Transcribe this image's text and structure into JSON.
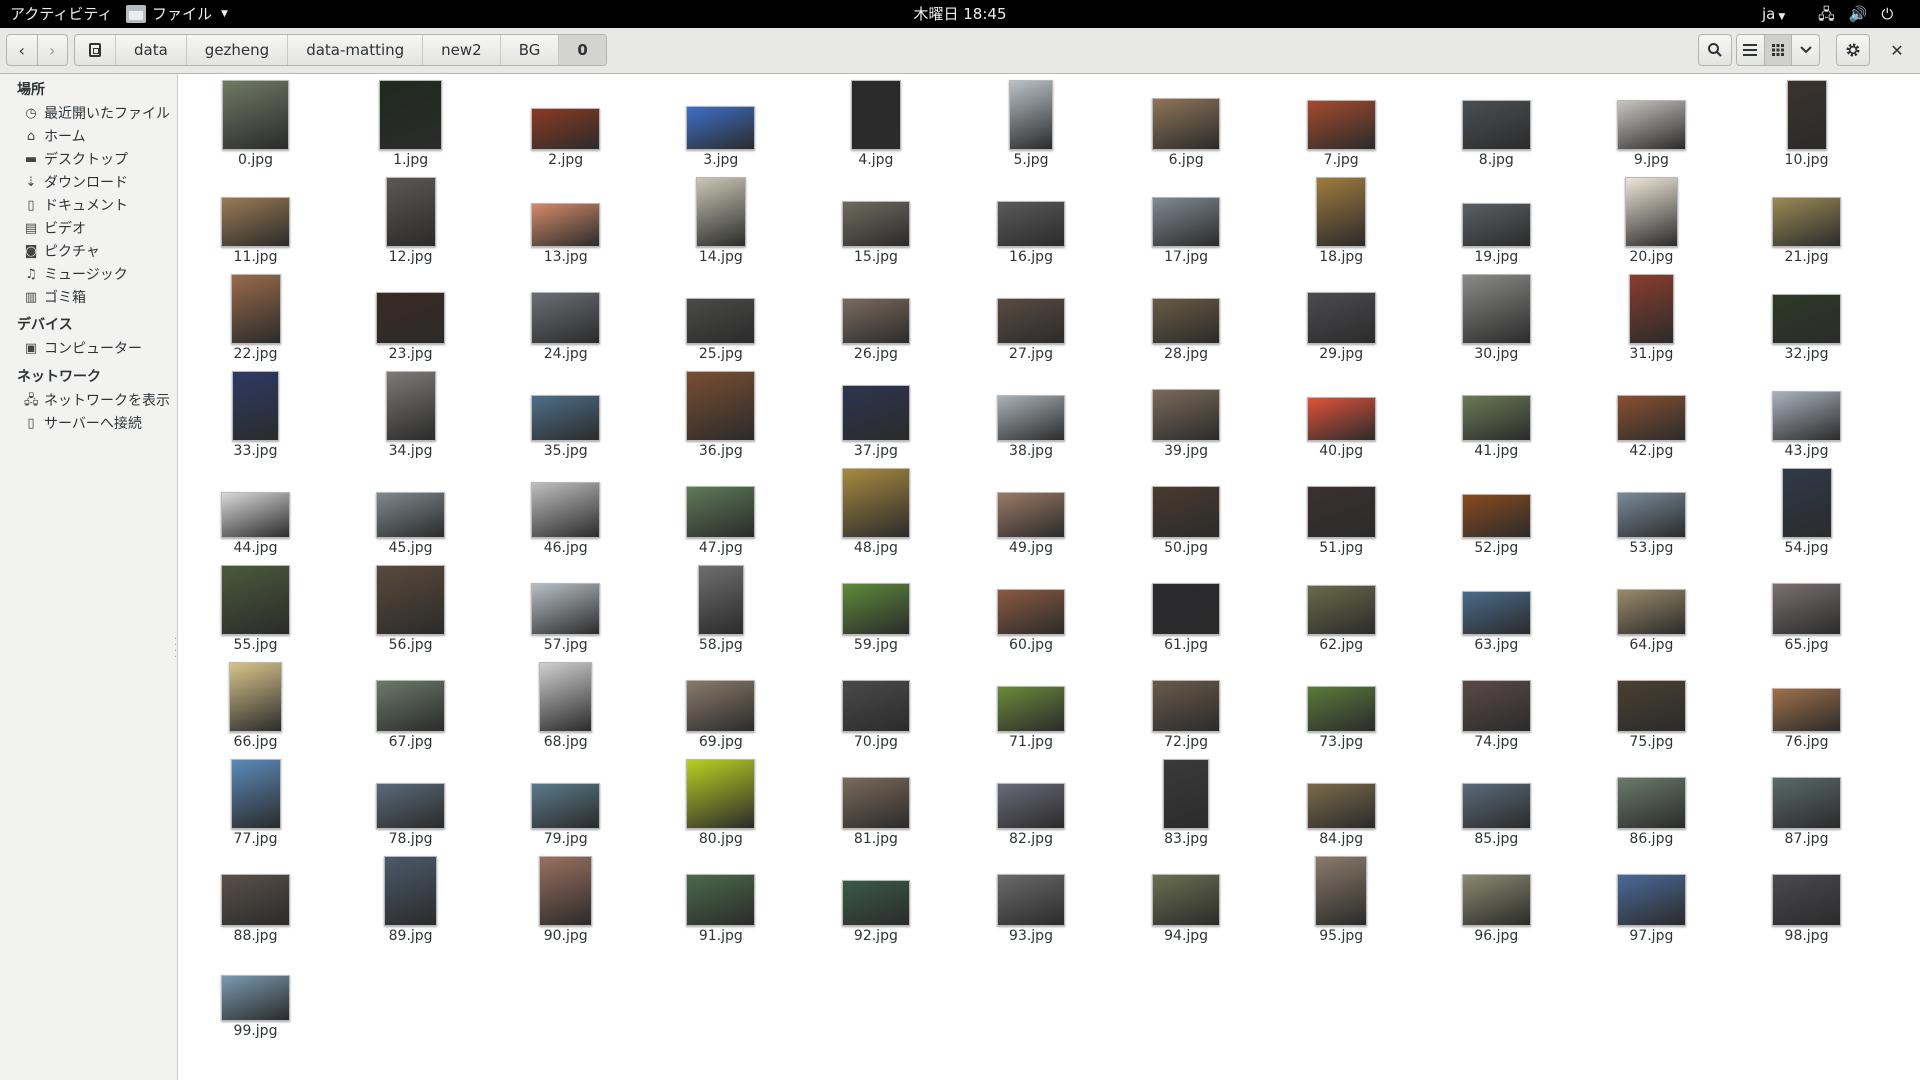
{
  "topbar": {
    "activities": "アクティビティ",
    "app_menu": "ファイル",
    "clock": "木曜日 18:45",
    "lang": "ja",
    "icons": [
      "network-icon",
      "volume-icon",
      "power-icon"
    ]
  },
  "header": {
    "back_icon": "chevron-left-icon",
    "forward_icon": "chevron-right-icon",
    "breadcrumbs": [
      "data",
      "gezheng",
      "data-matting",
      "new2",
      "BG",
      "0"
    ],
    "search_icon": "search-icon",
    "list_view_icon": "list-icon",
    "grid_view_icon": "grid-icon",
    "view_menu_icon": "chevron-down-icon",
    "gear_icon": "gear-icon",
    "close_icon": "close-icon"
  },
  "sidebar": {
    "places_title": "場所",
    "places": [
      {
        "label": "最近開いたファイル",
        "icon": "clock-icon"
      },
      {
        "label": "ホーム",
        "icon": "home-icon"
      },
      {
        "label": "デスクトップ",
        "icon": "folder-icon"
      },
      {
        "label": "ダウンロード",
        "icon": "download-icon"
      },
      {
        "label": "ドキュメント",
        "icon": "document-icon"
      },
      {
        "label": "ビデオ",
        "icon": "video-icon"
      },
      {
        "label": "ピクチャ",
        "icon": "camera-icon"
      },
      {
        "label": "ミュージック",
        "icon": "music-icon"
      },
      {
        "label": "ゴミ箱",
        "icon": "trash-icon"
      }
    ],
    "devices_title": "デバイス",
    "devices": [
      {
        "label": "コンピューター",
        "icon": "drive-icon"
      }
    ],
    "network_title": "ネットワーク",
    "network": [
      {
        "label": "ネットワークを表示",
        "icon": "network-icon"
      },
      {
        "label": "サーバーへ接続",
        "icon": "server-icon"
      }
    ]
  },
  "files": [
    "0.jpg",
    "1.jpg",
    "2.jpg",
    "3.jpg",
    "4.jpg",
    "5.jpg",
    "6.jpg",
    "7.jpg",
    "8.jpg",
    "9.jpg",
    "10.jpg",
    "11.jpg",
    "12.jpg",
    "13.jpg",
    "14.jpg",
    "15.jpg",
    "16.jpg",
    "17.jpg",
    "18.jpg",
    "19.jpg",
    "20.jpg",
    "21.jpg",
    "22.jpg",
    "23.jpg",
    "24.jpg",
    "25.jpg",
    "26.jpg",
    "27.jpg",
    "28.jpg",
    "29.jpg",
    "30.jpg",
    "31.jpg",
    "32.jpg",
    "33.jpg",
    "34.jpg",
    "35.jpg",
    "36.jpg",
    "37.jpg",
    "38.jpg",
    "39.jpg",
    "40.jpg",
    "41.jpg",
    "42.jpg",
    "43.jpg",
    "44.jpg",
    "45.jpg",
    "46.jpg",
    "47.jpg",
    "48.jpg",
    "49.jpg",
    "50.jpg",
    "51.jpg",
    "52.jpg",
    "53.jpg",
    "54.jpg",
    "55.jpg",
    "56.jpg",
    "57.jpg",
    "58.jpg",
    "59.jpg",
    "60.jpg",
    "61.jpg",
    "62.jpg",
    "63.jpg",
    "64.jpg",
    "65.jpg",
    "66.jpg",
    "67.jpg",
    "68.jpg",
    "69.jpg",
    "70.jpg",
    "71.jpg",
    "72.jpg",
    "73.jpg",
    "74.jpg",
    "75.jpg",
    "76.jpg",
    "77.jpg",
    "78.jpg",
    "79.jpg",
    "80.jpg",
    "81.jpg",
    "82.jpg",
    "83.jpg",
    "84.jpg",
    "85.jpg",
    "86.jpg",
    "87.jpg",
    "88.jpg",
    "89.jpg",
    "90.jpg",
    "91.jpg",
    "92.jpg",
    "93.jpg",
    "94.jpg",
    "95.jpg",
    "96.jpg",
    "97.jpg",
    "98.jpg",
    "99.jpg"
  ],
  "thumb_colors": [
    "#6f7a64",
    "#1f2a1e",
    "#8a3a22",
    "#3d6fc9",
    "#2a2a2a",
    "#b9c2c8",
    "#8e7458",
    "#a34a2e",
    "#4b4f52",
    "#c9c6c0",
    "#3b332c",
    "#9a7a55",
    "#5c5753",
    "#d48a6a",
    "#c9c7b4",
    "#6e6b5e",
    "#5a5a5a",
    "#7f8a93",
    "#a07b3e",
    "#5b5f63",
    "#efe6d8",
    "#9b8a55",
    "#9a6a4a",
    "#3a2a22",
    "#6b6e75",
    "#4a4a48",
    "#7b6a5e",
    "#5a4b42",
    "#6a5a43",
    "#4c4c50",
    "#8a8a88",
    "#8a3d2e",
    "#2d3a25",
    "#2e3a66",
    "#7d7a77",
    "#4d6f8a",
    "#7a4e32",
    "#2c3450",
    "#a9b2b8",
    "#7a6a5a",
    "#e0523a",
    "#6b7a55",
    "#8a5030",
    "#a9b2bd",
    "#d9d9d9",
    "#7e8a8f",
    "#bfbfbf",
    "#5e7a58",
    "#a88a40",
    "#9a7a66",
    "#4a3a2e",
    "#3b3030",
    "#8a4a1e",
    "#7a8a9a",
    "#2e3a4a",
    "#4a5a3a",
    "#5a4a3a",
    "#b7c0c6",
    "#6e6e6e",
    "#5e8a3a",
    "#8a5a40",
    "#2a2a30",
    "#6a6a4a",
    "#4a6a8a",
    "#9a8a6a",
    "#7a7070",
    "#d9c58a",
    "#6a7a6a",
    "#cfcfcf",
    "#8a7a6a",
    "#4a4a4a",
    "#6a8a3a",
    "#6a5a4a",
    "#5a7a3a",
    "#5a4a48",
    "#4a4030",
    "#a07048",
    "#5a8aba",
    "#5a6a7a",
    "#5a7a8a",
    "#b8d020",
    "#7a6a5a",
    "#6a6a7a",
    "#3a3a3a",
    "#7a6a4a",
    "#5a6a7a",
    "#6a7a6a",
    "#5a6a6a",
    "#5a5048",
    "#4a5a6a",
    "#9a7060",
    "#4a6a4a",
    "#3a5a4a",
    "#6a6a6a",
    "#6a7050",
    "#8a7a6a",
    "#8a8a70",
    "#4a6a9a",
    "#4a4a50",
    "#7a9ab0"
  ],
  "thumb_shapes": [
    [
      54,
      56
    ],
    [
      50,
      56
    ],
    [
      55,
      34
    ],
    [
      55,
      35
    ],
    [
      40,
      56
    ],
    [
      35,
      56
    ],
    [
      55,
      42
    ],
    [
      55,
      40
    ],
    [
      55,
      40
    ],
    [
      55,
      40
    ],
    [
      32,
      56
    ],
    [
      55,
      40
    ],
    [
      40,
      56
    ],
    [
      55,
      35
    ],
    [
      40,
      56
    ],
    [
      55,
      37
    ],
    [
      55,
      37
    ],
    [
      55,
      40
    ],
    [
      40,
      56
    ],
    [
      55,
      35
    ],
    [
      42,
      56
    ],
    [
      55,
      40
    ],
    [
      40,
      56
    ],
    [
      55,
      42
    ],
    [
      55,
      42
    ],
    [
      55,
      37
    ],
    [
      55,
      37
    ],
    [
      55,
      37
    ],
    [
      55,
      37
    ],
    [
      55,
      42
    ],
    [
      55,
      56
    ],
    [
      36,
      56
    ],
    [
      55,
      40
    ],
    [
      37,
      56
    ],
    [
      40,
      56
    ],
    [
      55,
      37
    ],
    [
      55,
      56
    ],
    [
      55,
      45
    ],
    [
      55,
      37
    ],
    [
      55,
      42
    ],
    [
      55,
      35
    ],
    [
      55,
      37
    ],
    [
      55,
      37
    ],
    [
      55,
      40
    ],
    [
      55,
      37
    ],
    [
      55,
      37
    ],
    [
      55,
      45
    ],
    [
      55,
      42
    ],
    [
      55,
      56
    ],
    [
      55,
      37
    ],
    [
      55,
      42
    ],
    [
      55,
      42
    ],
    [
      55,
      35
    ],
    [
      55,
      37
    ],
    [
      40,
      56
    ],
    [
      55,
      56
    ],
    [
      55,
      56
    ],
    [
      55,
      42
    ],
    [
      37,
      56
    ],
    [
      55,
      42
    ],
    [
      55,
      37
    ],
    [
      55,
      42
    ],
    [
      55,
      40
    ],
    [
      55,
      35
    ],
    [
      55,
      37
    ],
    [
      55,
      42
    ],
    [
      42,
      56
    ],
    [
      55,
      42
    ],
    [
      42,
      56
    ],
    [
      55,
      42
    ],
    [
      55,
      42
    ],
    [
      55,
      37
    ],
    [
      55,
      42
    ],
    [
      55,
      37
    ],
    [
      55,
      42
    ],
    [
      55,
      42
    ],
    [
      55,
      35
    ],
    [
      40,
      56
    ],
    [
      55,
      37
    ],
    [
      55,
      37
    ],
    [
      55,
      56
    ],
    [
      55,
      42
    ],
    [
      55,
      37
    ],
    [
      37,
      56
    ],
    [
      55,
      37
    ],
    [
      55,
      37
    ],
    [
      55,
      42
    ],
    [
      55,
      42
    ],
    [
      55,
      42
    ],
    [
      42,
      56
    ],
    [
      42,
      56
    ],
    [
      55,
      42
    ],
    [
      55,
      37
    ],
    [
      55,
      42
    ],
    [
      55,
      42
    ],
    [
      42,
      56
    ],
    [
      55,
      42
    ],
    [
      55,
      42
    ],
    [
      55,
      42
    ],
    [
      55,
      37
    ]
  ]
}
